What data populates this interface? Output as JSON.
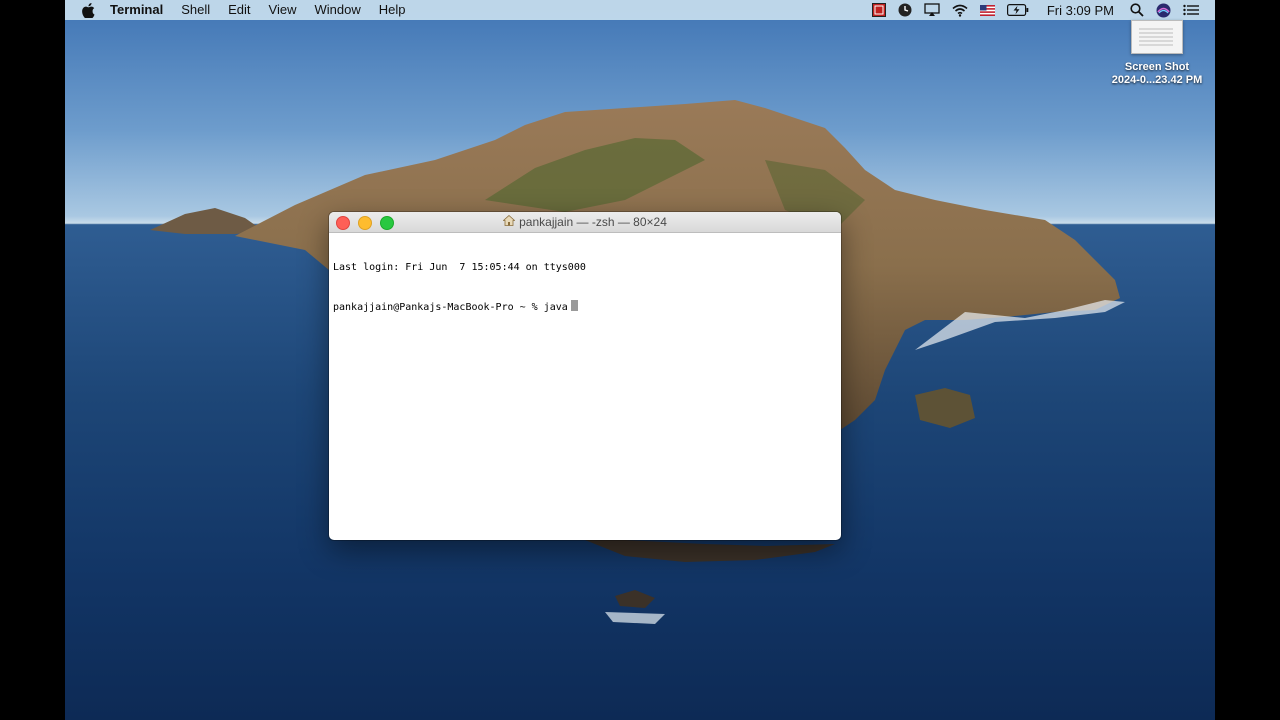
{
  "menubar": {
    "app_name": "Terminal",
    "items": [
      "Shell",
      "Edit",
      "View",
      "Window",
      "Help"
    ],
    "clock": "Fri 3:09 PM",
    "status_icons": [
      "screen-recorder-icon",
      "clock-widget-icon",
      "airplay-icon",
      "wifi-icon",
      "us-flag-icon",
      "battery-charging-icon",
      "spotlight-search-icon",
      "siri-icon",
      "control-center-icon"
    ]
  },
  "desktop": {
    "file_name_line1": "Screen Shot",
    "file_name_line2": "2024-0...23.42 PM"
  },
  "terminal": {
    "title": "pankajjain — -zsh — 80×24",
    "lines": [
      "Last login: Fri Jun  7 15:05:44 on ttys000",
      "pankajjain@Pankajs-MacBook-Pro ~ % java"
    ]
  },
  "colors": {
    "menubar_bg": "#c8deee",
    "close": "#fe5f57",
    "minimize": "#febc2e",
    "maximize": "#28c840",
    "sea": "#1d4677",
    "sky": "#6d9ccc"
  }
}
